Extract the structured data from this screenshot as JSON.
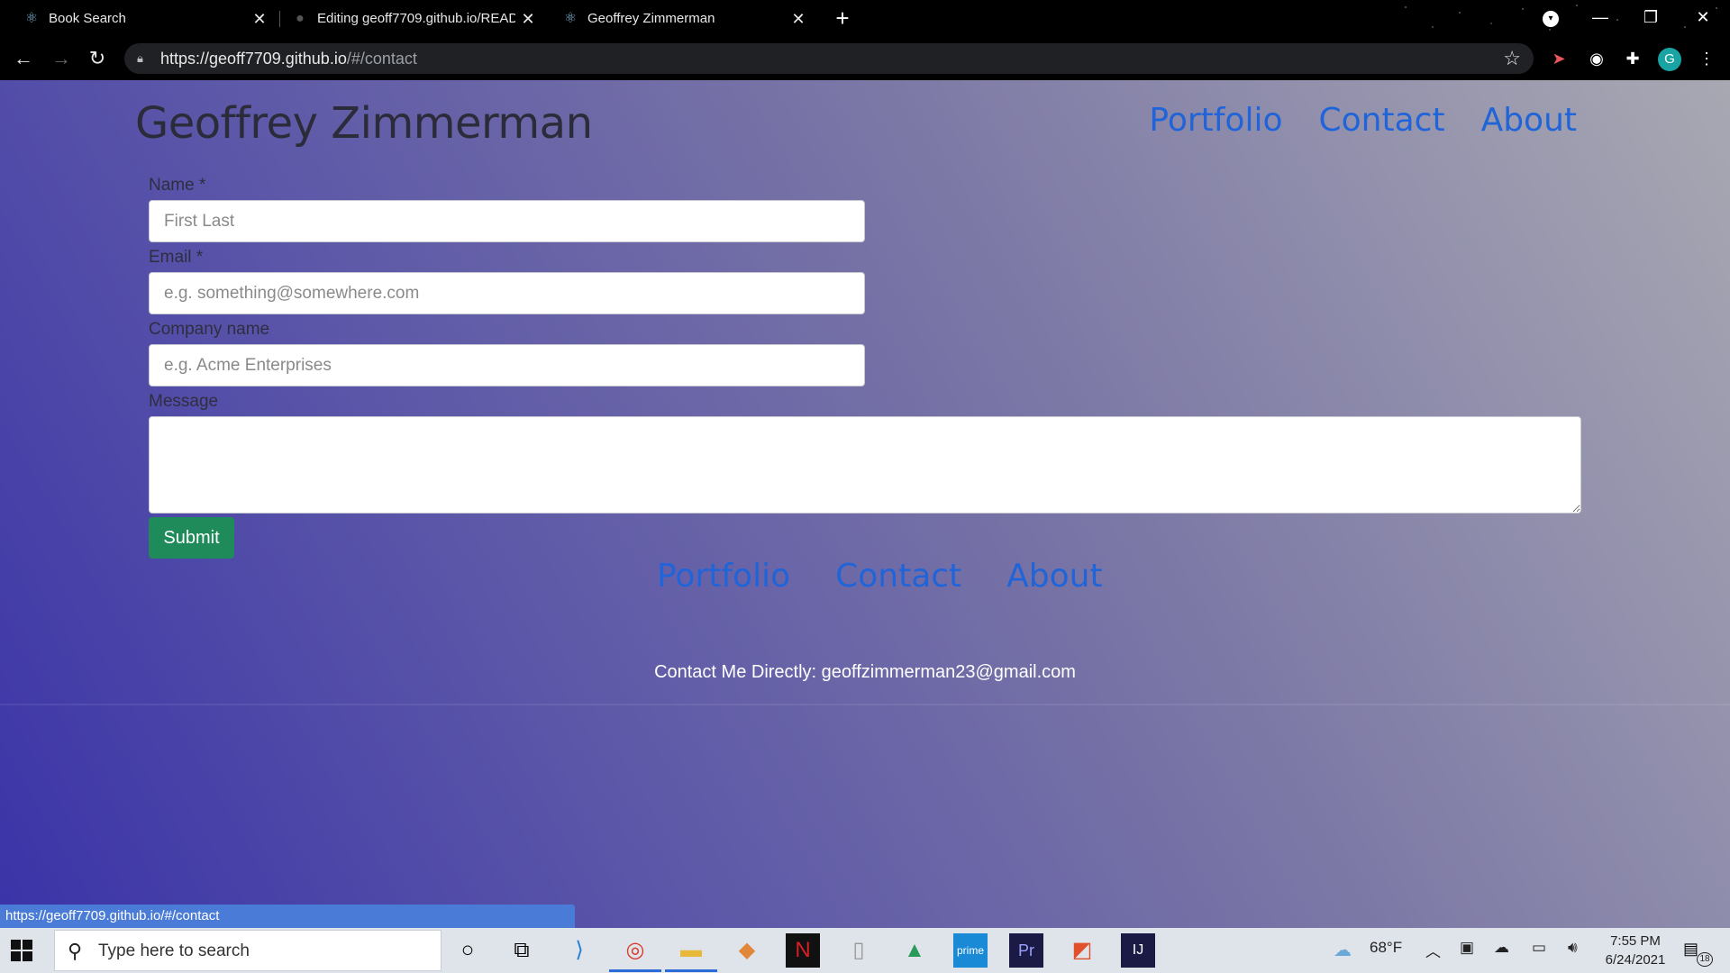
{
  "browser": {
    "tabs": [
      {
        "title": "Book Search",
        "icon": "react-icon"
      },
      {
        "title": "Editing geoff7709.github.io/READ",
        "icon": "github-icon"
      },
      {
        "title": "Geoffrey Zimmerman",
        "icon": "react-icon"
      }
    ],
    "url_host": "https://geoff7709.github.io",
    "url_path": "/#/contact",
    "profile_initial": "G"
  },
  "site": {
    "brand": "Geoffrey Zimmerman",
    "nav": [
      "Portfolio",
      "Contact",
      "About"
    ],
    "footer_nav": [
      "Portfolio",
      "Contact",
      "About"
    ],
    "footer_contact": "Contact Me Directly: geoffzimmerman23@gmail.com"
  },
  "form": {
    "name_label": "Name *",
    "name_placeholder": "First Last",
    "email_label": "Email *",
    "email_placeholder": "e.g. something@somewhere.com",
    "company_label": "Company name",
    "company_placeholder": "e.g. Acme Enterprises",
    "message_label": "Message",
    "message_value": "",
    "submit_label": "Submit"
  },
  "status_bar": {
    "url": "https://geoff7709.github.io/#/contact"
  },
  "taskbar": {
    "search_placeholder": "Type here to search",
    "weather": "68°F",
    "time": "7:55 PM",
    "date": "6/24/2021",
    "notification_count": "18"
  },
  "colors": {
    "link": "#1f64d8",
    "submit": "#1f8a5a",
    "status_bar": "#4a7bd6"
  }
}
